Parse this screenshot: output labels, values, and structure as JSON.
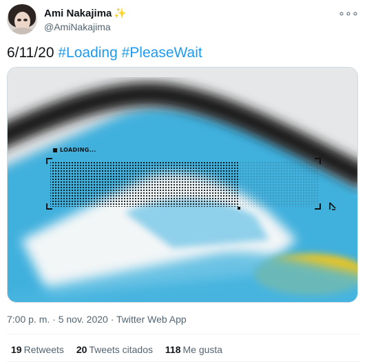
{
  "author": {
    "display_name": "Ami Nakajima",
    "handle": "@AmiNakajima",
    "badge_icon": "sparkles-icon"
  },
  "tweet": {
    "date_text": "6/11/20",
    "hashtags": [
      "#Loading",
      "#PleaseWait"
    ]
  },
  "media": {
    "overlay_label": "LOADING...",
    "progress_fraction": 0.7,
    "colors": {
      "phone_blue": "#3fb0dd",
      "yellow_accent": "#f0c61f",
      "frame_dark": "#1c1c1c"
    }
  },
  "meta": {
    "timestamp": "7:00 p. m. · 5 nov. 2020 · Twitter Web App"
  },
  "stats": {
    "retweets_count": "19",
    "retweets_label": "Retweets",
    "quotes_count": "20",
    "quotes_label": "Tweets citados",
    "likes_count": "118",
    "likes_label": "Me gusta"
  },
  "colors": {
    "link": "#1d9bf0",
    "secondary_text": "#536471",
    "primary_text": "#0f1419"
  }
}
